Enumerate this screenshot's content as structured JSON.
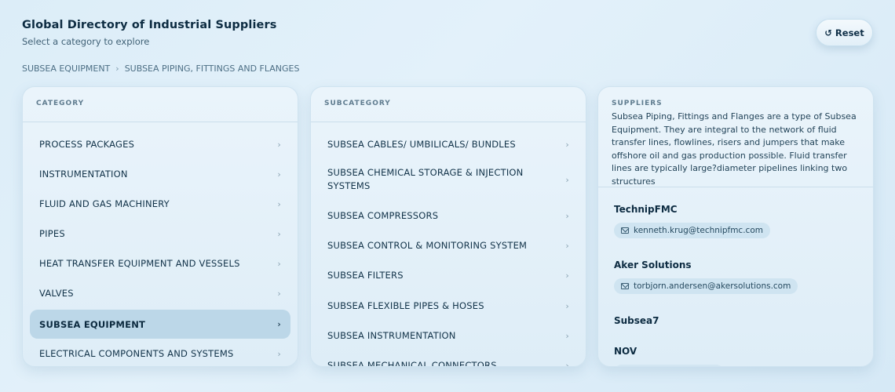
{
  "header": {
    "title": "Global Directory of Industrial Suppliers",
    "subtitle": "Select a category to explore"
  },
  "reset": {
    "icon": "↺",
    "label": "Reset"
  },
  "breadcrumb": {
    "items": [
      "SUBSEA EQUIPMENT",
      "SUBSEA PIPING, FITTINGS AND FLANGES"
    ],
    "separator": "›"
  },
  "category": {
    "heading": "CATEGORY",
    "items": [
      "PROCESS PACKAGES",
      "INSTRUMENTATION",
      "FLUID AND GAS MACHINERY",
      "PIPES",
      "HEAT TRANSFER EQUIPMENT AND VESSELS",
      "VALVES",
      "SUBSEA EQUIPMENT",
      "ELECTRICAL COMPONENTS AND SYSTEMS"
    ],
    "selected": "SUBSEA EQUIPMENT"
  },
  "subcategory": {
    "heading": "SUBCATEGORY",
    "items": [
      "SUBSEA CABLES/ UMBILICALS/ BUNDLES",
      "SUBSEA CHEMICAL STORAGE & INJECTION SYSTEMS",
      "SUBSEA COMPRESSORS",
      "SUBSEA CONTROL & MONITORING SYSTEM",
      "SUBSEA FILTERS",
      "SUBSEA FLEXIBLE PIPES & HOSES",
      "SUBSEA INSTRUMENTATION",
      "SUBSEA MECHANICAL CONNECTORS"
    ]
  },
  "suppliers": {
    "heading": "SUPPLIERS",
    "description": "Subsea Piping, Fittings and Flanges are a type of Subsea Equipment. They are integral to the network of fluid transfer lines, flowlines, risers and jumpers that make offshore oil and gas production possible. Fluid transfer lines are typically large?diameter pipelines linking two structures",
    "list": [
      {
        "name": "TechnipFMC",
        "email": "kenneth.krug@technipfmc.com"
      },
      {
        "name": "Aker Solutions",
        "email": "torbjorn.andersen@akersolutions.com"
      },
      {
        "name": "Subsea7"
      },
      {
        "name": "NOV"
      }
    ]
  },
  "chevron": "›"
}
